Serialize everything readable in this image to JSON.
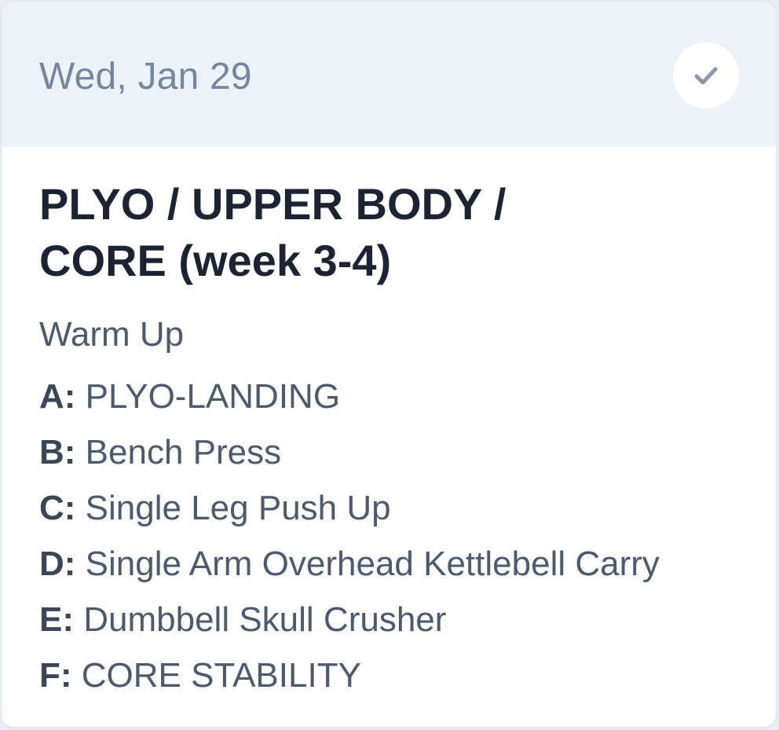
{
  "header": {
    "date": "Wed, Jan 29",
    "status_icon": "check-icon",
    "status_color": "#8a99ad",
    "background": "#edf2f8"
  },
  "workout": {
    "title_line1": "PLYO / UPPER BODY /",
    "title_line2": "CORE (week 3-4)",
    "warmup": "Warm Up",
    "exercises": [
      {
        "letter": "A:",
        "name": "PLYO-LANDING"
      },
      {
        "letter": "B:",
        "name": "Bench Press"
      },
      {
        "letter": "C:",
        "name": "Single Leg Push Up"
      },
      {
        "letter": "D:",
        "name": "Single Arm Overhead Kettlebell Carry"
      },
      {
        "letter": "E:",
        "name": "Dumbbell Skull Crusher"
      },
      {
        "letter": "F:",
        "name": "CORE STABILITY"
      }
    ]
  }
}
